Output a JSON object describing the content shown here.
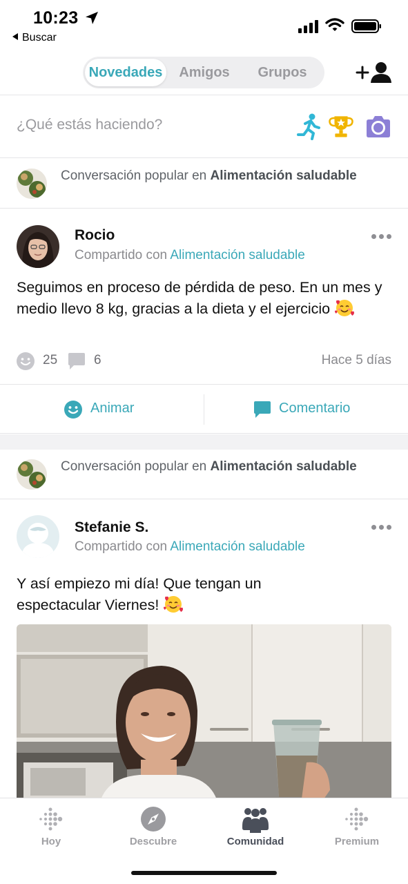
{
  "status_bar": {
    "time": "10:23",
    "back_app": "Buscar"
  },
  "top_nav": {
    "tabs": [
      {
        "label": "Novedades",
        "active": true
      },
      {
        "label": "Amigos",
        "active": false
      },
      {
        "label": "Grupos",
        "active": false
      }
    ]
  },
  "composer": {
    "placeholder": "¿Qué estás haciendo?"
  },
  "feed": [
    {
      "popular_prefix": "Conversación popular en",
      "group_name": "Alimentación saludable",
      "author": "Rocio",
      "shared_prefix": "Compartido con",
      "shared_group": "Alimentación saludable",
      "text": "Seguimos en proceso de pérdida de peso. En un mes y medio llevo 8 kg, gracias a la dieta y el ejercicio",
      "cheers": "25",
      "comments": "6",
      "time_ago": "Hace 5 días",
      "cheer_label": "Animar",
      "comment_label": "Comentario"
    },
    {
      "popular_prefix": "Conversación popular en",
      "group_name": "Alimentación saludable",
      "author": "Stefanie S.",
      "shared_prefix": "Compartido con",
      "shared_group": "Alimentación saludable",
      "text": "Y así empiezo mi día! Que tengan un espectacular Viernes!"
    }
  ],
  "tab_bar": {
    "tabs": [
      {
        "label": "Hoy",
        "icon": "fitbit-dots-icon",
        "active": false
      },
      {
        "label": "Descubre",
        "icon": "compass-icon",
        "active": false
      },
      {
        "label": "Comunidad",
        "icon": "community-icon",
        "active": true
      },
      {
        "label": "Premium",
        "icon": "premium-dots-icon",
        "active": false
      }
    ]
  },
  "colors": {
    "accent": "#3aa8b8",
    "running": "#31b7d6",
    "trophy": "#f0b400",
    "camera": "#8c7fd6"
  }
}
